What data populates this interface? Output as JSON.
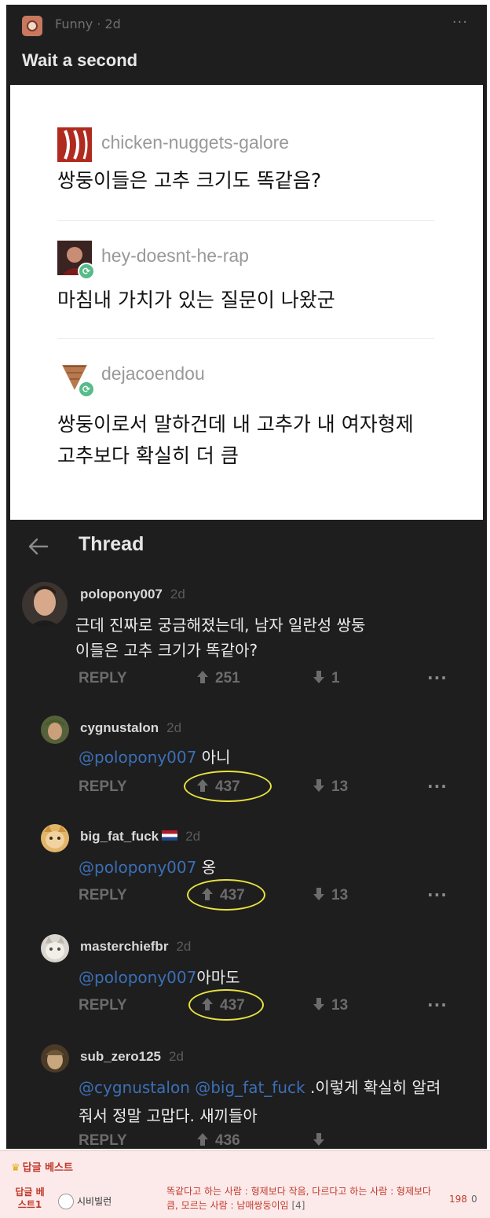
{
  "post": {
    "community": "Funny",
    "age": "2d",
    "community_line": "Funny · 2d",
    "more": "···",
    "title": "Wait a second"
  },
  "tumblr": [
    {
      "user": "chicken-nuggets-galore",
      "lines": [
        "쌍둥이들은 고추 크기도 똑같음?"
      ]
    },
    {
      "user": "hey-doesnt-he-rap",
      "lines": [
        "마침내 가치가 있는 질문이 나왔군"
      ]
    },
    {
      "user": "dejacoendou",
      "lines": [
        "쌍둥이로서 말하건데 내 고추가 내 여자형제",
        "고추보다 확실히 더 큼"
      ]
    }
  ],
  "thread": {
    "title": "Thread",
    "comments": [
      {
        "user": "polopony007",
        "time": "2d",
        "lines": [
          "근데 진짜로 궁금해졌는데, 남자 일란성 쌍둥",
          "이들은 고추 크기가 똑같아?"
        ],
        "reply": "REPLY",
        "up": "251",
        "down": "1",
        "more": "···"
      },
      {
        "user": "cygnustalon",
        "time": "2d",
        "mention": "@polopony007",
        "text": " 아니",
        "reply": "REPLY",
        "up": "437",
        "down": "13",
        "more": "···"
      },
      {
        "user": "big_fat_fuck",
        "time": "2d",
        "mention": "@polopony007",
        "text": " 옹",
        "reply": "REPLY",
        "up": "437",
        "down": "13",
        "more": "···"
      },
      {
        "user": "masterchiefbr",
        "time": "2d",
        "mention": "@polopony007",
        "text": "아마도",
        "reply": "REPLY",
        "up": "437",
        "down": "13",
        "more": "···"
      },
      {
        "user": "sub_zero125",
        "time": "2d",
        "mention": "@cygnustalon @big_fat_fuck",
        "text": " .이렇게 확실히 알려",
        "line2": "줘서 정말 고맙다. 새끼들아",
        "reply": "REPLY",
        "up": "436"
      }
    ]
  },
  "best_reply": {
    "header": "답글 베스트",
    "label": "답글 베스트1",
    "user": "시비빌런",
    "text": "똑같다고 하는 사람 : 형제보다 작음, 다르다고 하는 사람 : 형제보다 큼, 모르는 사람 : 남매쌍둥이임",
    "reply_count": "[4]",
    "up": "198",
    "down": "0"
  },
  "colors": {
    "background": "#1e1e1e",
    "mention": "#3b6fb6",
    "highlight_circle": "#e8e240",
    "best_red": "#c0392b"
  }
}
